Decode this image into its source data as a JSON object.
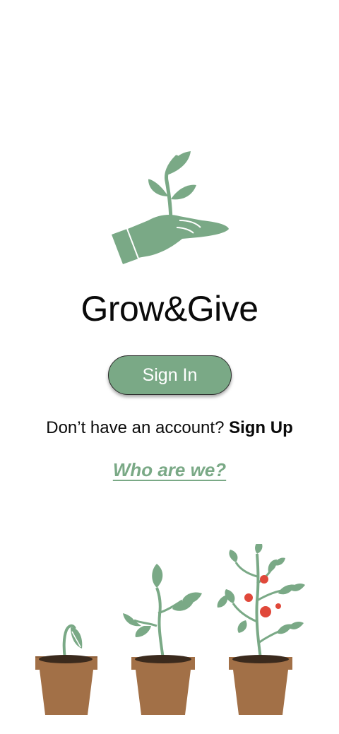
{
  "app": {
    "title": "Grow&Give"
  },
  "auth": {
    "sign_in_label": "Sign In",
    "signup_prompt": "Don’t have an account?",
    "signup_link": "Sign Up",
    "about_link": "Who are we?"
  },
  "icons": {
    "logo": "hand-holding-sprout-icon",
    "plant_stage_1": "seedling-pot-icon",
    "plant_stage_2": "young-plant-pot-icon",
    "plant_stage_3": "tomato-plant-pot-icon"
  },
  "colors": {
    "brand_green": "#7aa986",
    "pot_brown": "#a27047",
    "soil": "#3b2a1d",
    "tomato_red": "#e0483a"
  }
}
